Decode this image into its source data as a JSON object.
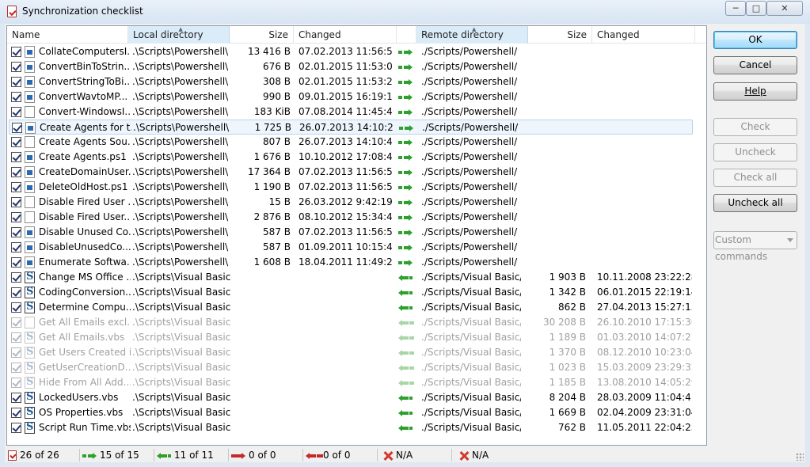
{
  "window": {
    "title": "Synchronization checklist",
    "buttons": {
      "minimize": "─",
      "maximize": "□",
      "close": "✕"
    }
  },
  "columns": {
    "name": "Name",
    "local_dir": "Local directory",
    "local_size": "Size",
    "local_changed": "Changed",
    "remote_dir": "Remote directory",
    "remote_size": "Size",
    "remote_changed": "Changed"
  },
  "rows": [
    {
      "checked": true,
      "dim": false,
      "icon": "ps",
      "name": "CollateComputersI...",
      "ldir": ".\\Scripts\\Powershell\\",
      "lsize": "13 416 B",
      "lchg": "07.02.2013 11:56:59",
      "dir": "upload",
      "rdir": "./Scripts/Powershell/",
      "rsize": "",
      "rchg": ""
    },
    {
      "checked": true,
      "dim": false,
      "icon": "ps",
      "name": "ConvertBinToStrin...",
      "ldir": ".\\Scripts\\Powershell\\",
      "lsize": "676 B",
      "lchg": "02.01.2015 11:53:09",
      "dir": "upload",
      "rdir": "./Scripts/Powershell/",
      "rsize": "",
      "rchg": ""
    },
    {
      "checked": true,
      "dim": false,
      "icon": "ps",
      "name": "ConvertStringToBi...",
      "ldir": ".\\Scripts\\Powershell\\",
      "lsize": "308 B",
      "lchg": "02.01.2015 11:53:29",
      "dir": "upload",
      "rdir": "./Scripts/Powershell/",
      "rsize": "",
      "rchg": ""
    },
    {
      "checked": true,
      "dim": false,
      "icon": "ps",
      "name": "ConvertWavtoMP...",
      "ldir": ".\\Scripts\\Powershell\\",
      "lsize": "990 B",
      "lchg": "09.01.2015 16:19:16",
      "dir": "upload",
      "rdir": "./Scripts/Powershell/",
      "rsize": "",
      "rchg": ""
    },
    {
      "checked": true,
      "dim": false,
      "icon": "file",
      "name": "Convert-WindowsI...",
      "ldir": ".\\Scripts\\Powershell\\",
      "lsize": "183 KiB",
      "lchg": "07.08.2014 11:45:40",
      "dir": "upload",
      "rdir": "./Scripts/Powershell/",
      "rsize": "",
      "rchg": ""
    },
    {
      "checked": true,
      "dim": false,
      "icon": "ps",
      "name": "Create Agents for t...",
      "ldir": ".\\Scripts\\Powershell\\",
      "lsize": "1 725 B",
      "lchg": "26.07.2013 14:10:23",
      "dir": "upload",
      "rdir": "./Scripts/Powershell/",
      "rsize": "",
      "rchg": "",
      "selected": true
    },
    {
      "checked": true,
      "dim": false,
      "icon": "file",
      "name": "Create Agents Sou...",
      "ldir": ".\\Scripts\\Powershell\\",
      "lsize": "807 B",
      "lchg": "26.07.2013 14:10:46",
      "dir": "upload",
      "rdir": "./Scripts/Powershell/",
      "rsize": "",
      "rchg": ""
    },
    {
      "checked": true,
      "dim": false,
      "icon": "ps",
      "name": "Create Agents.ps1",
      "ldir": ".\\Scripts\\Powershell\\",
      "lsize": "1 676 B",
      "lchg": "10.10.2012 17:08:47",
      "dir": "upload",
      "rdir": "./Scripts/Powershell/",
      "rsize": "",
      "rchg": ""
    },
    {
      "checked": true,
      "dim": false,
      "icon": "ps",
      "name": "CreateDomainUser...",
      "ldir": ".\\Scripts\\Powershell\\",
      "lsize": "17 364 B",
      "lchg": "07.02.2013 11:56:59",
      "dir": "upload",
      "rdir": "./Scripts/Powershell/",
      "rsize": "",
      "rchg": ""
    },
    {
      "checked": true,
      "dim": false,
      "icon": "ps",
      "name": "DeleteOldHost.ps1",
      "ldir": ".\\Scripts\\Powershell\\",
      "lsize": "1 190 B",
      "lchg": "07.02.2013 11:56:59",
      "dir": "upload",
      "rdir": "./Scripts/Powershell/",
      "rsize": "",
      "rchg": ""
    },
    {
      "checked": true,
      "dim": false,
      "icon": "file",
      "name": "Disable Fired User ...",
      "ldir": ".\\Scripts\\Powershell\\",
      "lsize": "15 B",
      "lchg": "26.03.2012 9:42:19",
      "dir": "upload",
      "rdir": "./Scripts/Powershell/",
      "rsize": "",
      "rchg": ""
    },
    {
      "checked": true,
      "dim": false,
      "icon": "file",
      "name": "Disable Fired User...",
      "ldir": ".\\Scripts\\Powershell\\",
      "lsize": "2 876 B",
      "lchg": "08.10.2012 15:34:46",
      "dir": "upload",
      "rdir": "./Scripts/Powershell/",
      "rsize": "",
      "rchg": ""
    },
    {
      "checked": true,
      "dim": false,
      "icon": "ps",
      "name": "Disable Unused Co...",
      "ldir": ".\\Scripts\\Powershell\\",
      "lsize": "587 B",
      "lchg": "07.02.2013 11:56:59",
      "dir": "upload",
      "rdir": "./Scripts/Powershell/",
      "rsize": "",
      "rchg": ""
    },
    {
      "checked": true,
      "dim": false,
      "icon": "ps",
      "name": "DisableUnusedCo...",
      "ldir": ".\\Scripts\\Powershell\\",
      "lsize": "587 B",
      "lchg": "01.09.2011 10:15:46",
      "dir": "upload",
      "rdir": "./Scripts/Powershell/",
      "rsize": "",
      "rchg": ""
    },
    {
      "checked": true,
      "dim": false,
      "icon": "ps",
      "name": "Enumerate Softwa...",
      "ldir": ".\\Scripts\\Powershell\\",
      "lsize": "1 608 B",
      "lchg": "18.04.2011 11:49:24",
      "dir": "upload",
      "rdir": "./Scripts/Powershell/",
      "rsize": "",
      "rchg": ""
    },
    {
      "checked": true,
      "dim": false,
      "icon": "vbs",
      "name": "Change MS Office ...",
      "ldir": ".\\Scripts\\Visual Basic\\",
      "lsize": "",
      "lchg": "",
      "dir": "download",
      "rdir": "./Scripts/Visual Basic/",
      "rsize": "1 903 B",
      "rchg": "10.11.2008 23:22:28"
    },
    {
      "checked": true,
      "dim": false,
      "icon": "vbs",
      "name": "CodingConversion...",
      "ldir": ".\\Scripts\\Visual Basic\\",
      "lsize": "",
      "lchg": "",
      "dir": "download",
      "rdir": "./Scripts/Visual Basic/",
      "rsize": "1 342 B",
      "rchg": "06.01.2015 22:19:14"
    },
    {
      "checked": true,
      "dim": false,
      "icon": "vbs",
      "name": "Determine Compu...",
      "ldir": ".\\Scripts\\Visual Basic\\",
      "lsize": "",
      "lchg": "",
      "dir": "download",
      "rdir": "./Scripts/Visual Basic/",
      "rsize": "862 B",
      "rchg": "27.04.2013 15:27:15"
    },
    {
      "checked": true,
      "dim": true,
      "icon": "file",
      "name": "Get All Emails excl...",
      "ldir": ".\\Scripts\\Visual Basic\\",
      "lsize": "",
      "lchg": "",
      "dir": "download",
      "rdir": "./Scripts/Visual Basic/",
      "rsize": "30 208 B",
      "rchg": "26.10.2010 17:15:36"
    },
    {
      "checked": true,
      "dim": true,
      "icon": "vbs",
      "name": "Get All Emails.vbs",
      "ldir": ".\\Scripts\\Visual Basic\\",
      "lsize": "",
      "lchg": "",
      "dir": "download",
      "rdir": "./Scripts/Visual Basic/",
      "rsize": "1 189 B",
      "rchg": "01.03.2010 14:07:27"
    },
    {
      "checked": true,
      "dim": true,
      "icon": "vbs",
      "name": "Get Users Created i...",
      "ldir": ".\\Scripts\\Visual Basic\\",
      "lsize": "",
      "lchg": "",
      "dir": "download",
      "rdir": "./Scripts/Visual Basic/",
      "rsize": "1 370 B",
      "rchg": "08.12.2010 10:23:04"
    },
    {
      "checked": true,
      "dim": true,
      "icon": "vbs",
      "name": "GetUserCreationD...",
      "ldir": ".\\Scripts\\Visual Basic\\",
      "lsize": "",
      "lchg": "",
      "dir": "download",
      "rdir": "./Scripts/Visual Basic/",
      "rsize": "1 023 B",
      "rchg": "15.03.2009 23:29:32"
    },
    {
      "checked": true,
      "dim": true,
      "icon": "vbs",
      "name": "Hide From All Add...",
      "ldir": ".\\Scripts\\Visual Basic\\",
      "lsize": "",
      "lchg": "",
      "dir": "download",
      "rdir": "./Scripts/Visual Basic/",
      "rsize": "1 185 B",
      "rchg": "13.08.2010 14:05:29"
    },
    {
      "checked": true,
      "dim": false,
      "icon": "vbs",
      "name": "LockedUsers.vbs",
      "ldir": ".\\Scripts\\Visual Basic\\",
      "lsize": "",
      "lchg": "",
      "dir": "download",
      "rdir": "./Scripts/Visual Basic/",
      "rsize": "8 204 B",
      "rchg": "28.03.2009 11:04:41"
    },
    {
      "checked": true,
      "dim": false,
      "icon": "vbs",
      "name": "OS Properties.vbs",
      "ldir": ".\\Scripts\\Visual Basic\\",
      "lsize": "",
      "lchg": "",
      "dir": "download",
      "rdir": "./Scripts/Visual Basic/",
      "rsize": "1 669 B",
      "rchg": "02.04.2009 23:31:04"
    },
    {
      "checked": true,
      "dim": false,
      "icon": "vbs",
      "name": "Script Run Time.vbs",
      "ldir": ".\\Scripts\\Visual Basic\\",
      "lsize": "",
      "lchg": "",
      "dir": "download",
      "rdir": "./Scripts/Visual Basic/",
      "rsize": "762 B",
      "rchg": "11.05.2011 22:04:23"
    }
  ],
  "buttons": {
    "ok": "OK",
    "cancel": "Cancel",
    "help": "Help",
    "check": "Check",
    "uncheck": "Uncheck",
    "check_all": "Check all",
    "uncheck_all": "Uncheck all",
    "custom_commands": "Custom commands"
  },
  "status": {
    "checked": "26 of 26",
    "upload": "15 of 15",
    "download": "11 of 11",
    "delete_remote": "0 of 0",
    "delete_local": "0 of 0",
    "na1": "N/A",
    "na2": "N/A"
  }
}
